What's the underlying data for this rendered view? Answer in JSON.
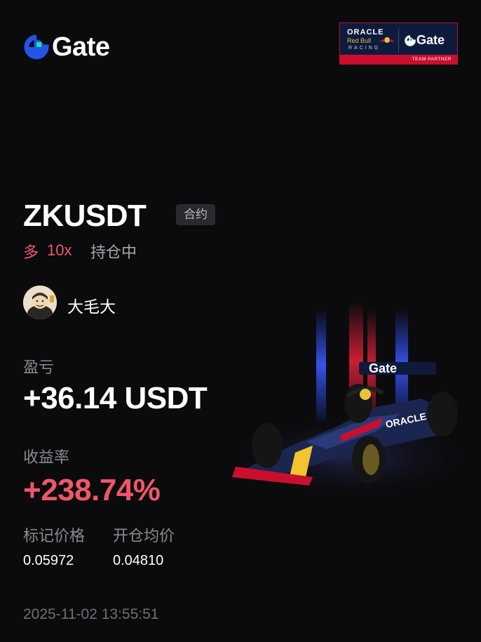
{
  "brand": {
    "name": "Gate",
    "accent": "#2354e6",
    "accent2": "#17e6a1"
  },
  "partner_badge": {
    "oracle": "ORACLE",
    "redbull": "Red Bull",
    "racing": "RACING",
    "gate": "Gate",
    "label": "TEAM PARTNER"
  },
  "position": {
    "symbol": "ZKUSDT",
    "type_tag": "合约",
    "direction": "多",
    "leverage": "10x",
    "status": "持仓中"
  },
  "user": {
    "name": "大毛大"
  },
  "pnl": {
    "label": "盈亏",
    "value": "+36.14 USDT"
  },
  "roi": {
    "label": "收益率",
    "value": "+238.74%"
  },
  "prices": {
    "mark_label": "标记价格",
    "mark_value": "0.05972",
    "entry_label": "开仓均价",
    "entry_value": "0.04810"
  },
  "timestamp": "2025-11-02 13:55:51",
  "colors": {
    "profit": "#f0566a",
    "background": "#0b0b0d",
    "muted": "#8a8a91"
  },
  "illustration": {
    "car_label": "Gate",
    "sponsor": "ORACLE"
  }
}
